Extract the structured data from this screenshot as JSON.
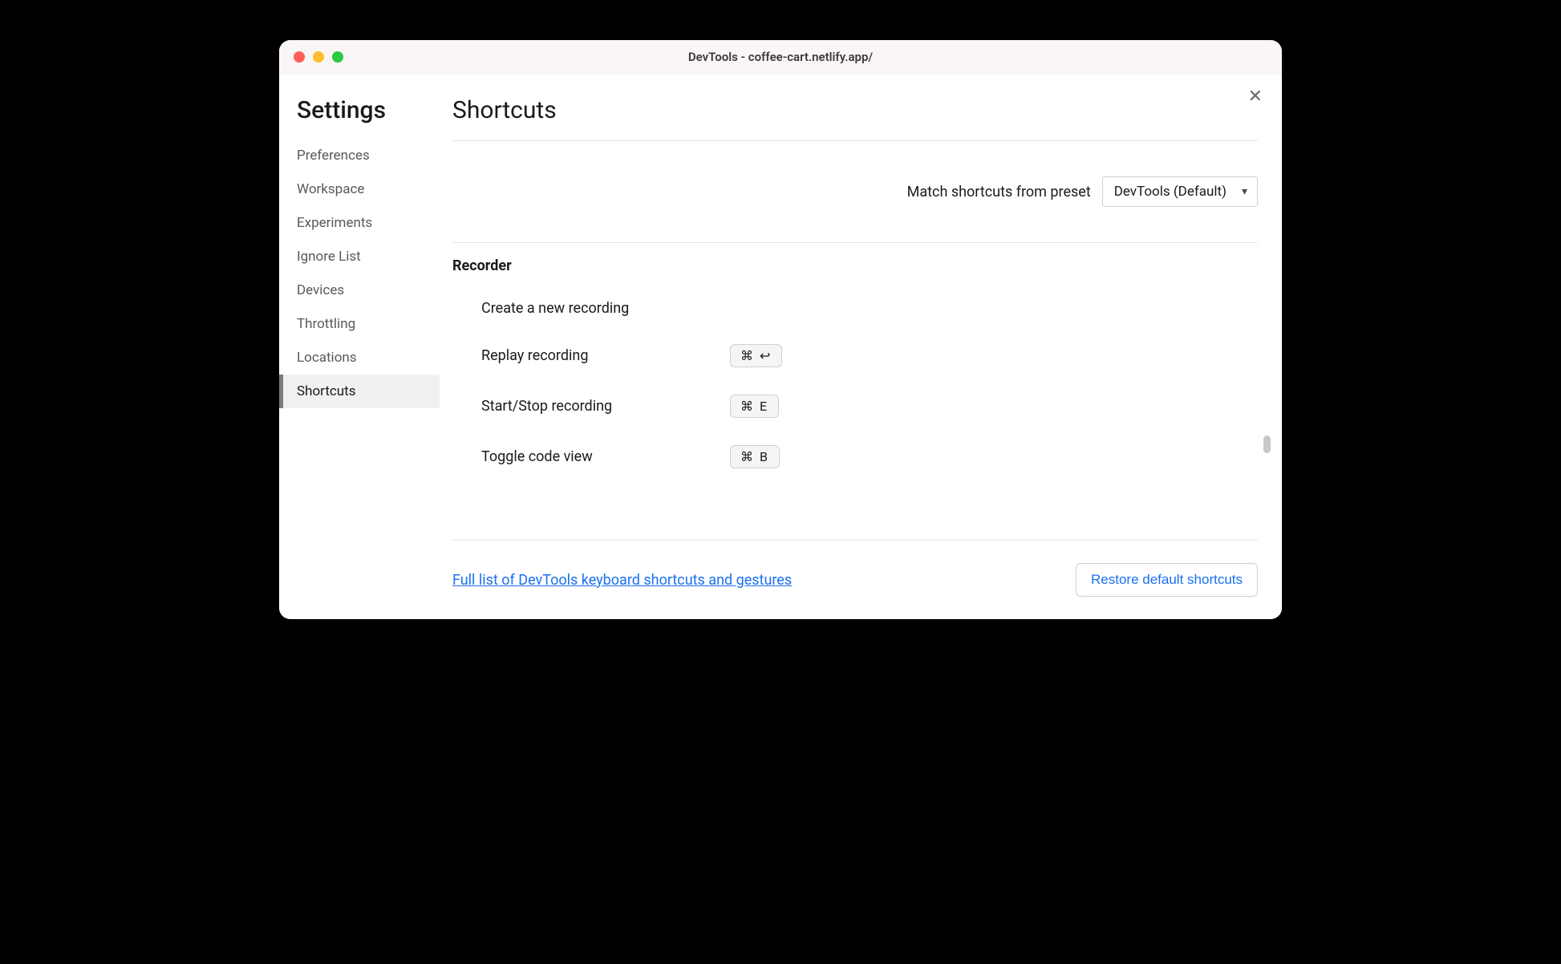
{
  "window": {
    "title": "DevTools - coffee-cart.netlify.app/"
  },
  "sidebar": {
    "title": "Settings",
    "items": [
      {
        "label": "Preferences",
        "active": false
      },
      {
        "label": "Workspace",
        "active": false
      },
      {
        "label": "Experiments",
        "active": false
      },
      {
        "label": "Ignore List",
        "active": false
      },
      {
        "label": "Devices",
        "active": false
      },
      {
        "label": "Throttling",
        "active": false
      },
      {
        "label": "Locations",
        "active": false
      },
      {
        "label": "Shortcuts",
        "active": true
      }
    ]
  },
  "main": {
    "heading": "Shortcuts",
    "preset_label": "Match shortcuts from preset",
    "preset_value": "DevTools (Default)",
    "section_title": "Recorder",
    "shortcuts": [
      {
        "label": "Create a new recording",
        "keys": ""
      },
      {
        "label": "Replay recording",
        "keys": "⌘ ↩"
      },
      {
        "label": "Start/Stop recording",
        "keys": "⌘ E"
      },
      {
        "label": "Toggle code view",
        "keys": "⌘ B"
      }
    ],
    "footer_link": "Full list of DevTools keyboard shortcuts and gestures",
    "restore_label": "Restore default shortcuts"
  }
}
